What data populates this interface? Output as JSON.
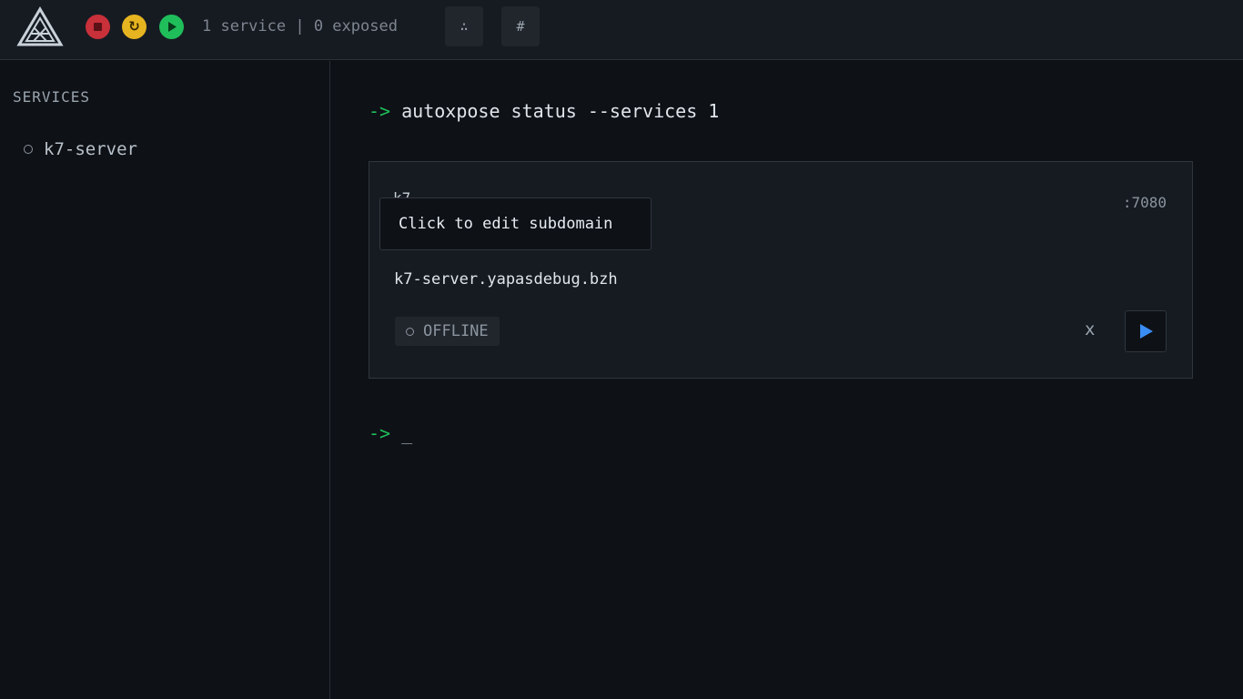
{
  "topbar": {
    "status_text": "1 service | 0 exposed",
    "buttons": {
      "stop": "stop-icon",
      "restart_glyph": "↻",
      "play": "play-icon",
      "graph_glyph": "∴",
      "hash_glyph": "#"
    }
  },
  "sidebar": {
    "heading": "SERVICES",
    "items": [
      {
        "label": "k7-server"
      }
    ]
  },
  "main": {
    "prompt_arrow": "->",
    "command": "autoxpose status --services 1",
    "cursor": "_",
    "card": {
      "name": "k7-",
      "port": ":7080",
      "tooltip": "Click to edit subdomain",
      "domain": "k7-server.yapasdebug.bzh",
      "status": "OFFLINE",
      "remove_label": "x"
    }
  },
  "colors": {
    "accent_green": "#1fbe5a",
    "stop_red": "#c8303a",
    "restart_yellow": "#e6b420",
    "play_blue": "#3a8df5"
  }
}
